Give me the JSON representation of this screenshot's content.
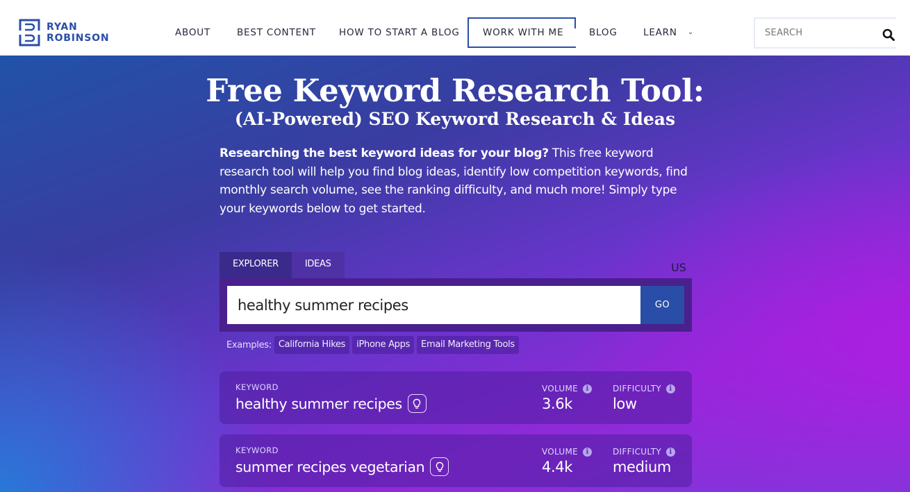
{
  "header": {
    "logo": {
      "line1": "RYAN",
      "line2": "ROBINSON"
    },
    "nav": [
      {
        "label": "ABOUT"
      },
      {
        "label": "BEST CONTENT"
      },
      {
        "label": "HOW TO START A BLOG"
      },
      {
        "label": "WORK WITH ME",
        "active": true
      },
      {
        "label": "BLOG"
      },
      {
        "label": "LEARN",
        "has_dropdown": true
      }
    ],
    "search": {
      "placeholder": "SEARCH",
      "value": ""
    }
  },
  "hero": {
    "title": "Free Keyword Research Tool:",
    "subtitle": "(AI-Powered) SEO Keyword Research & Ideas",
    "intro_bold": "Researching the best keyword ideas for your blog?",
    "intro_rest": " This free keyword research tool will help you find blog ideas, identify low competition keywords, find monthly search volume, see the ranking difficulty, and much more! Simply type your keywords below to get started."
  },
  "tool": {
    "tabs": [
      {
        "label": "EXPLORER",
        "active": true
      },
      {
        "label": "IDEAS",
        "active": false
      }
    ],
    "region": "US",
    "input_value": "healthy summer recipes",
    "go_label": "GO",
    "examples_label": "Examples:",
    "examples": [
      "California Hikes",
      "iPhone Apps",
      "Email Marketing Tools"
    ]
  },
  "results": [
    {
      "keyword_label": "KEYWORD",
      "keyword": "healthy summer recipes",
      "volume_label": "VOLUME",
      "volume": "3.6k",
      "difficulty_label": "DIFFICULTY",
      "difficulty": "low"
    },
    {
      "keyword_label": "KEYWORD",
      "keyword": "summer recipes vegetarian",
      "volume_label": "VOLUME",
      "volume": "4.4k",
      "difficulty_label": "DIFFICULTY",
      "difficulty": "medium"
    }
  ],
  "colors": {
    "brand_blue": "#2a4ea8",
    "nav_text": "#26283a",
    "panel_purple": "#4a1f8e",
    "tab_active": "#3a2a8c"
  },
  "icons": {
    "search": "search-icon",
    "chevron": "chevron-down-icon",
    "bulb": "lightbulb-icon",
    "info": "info-icon"
  }
}
